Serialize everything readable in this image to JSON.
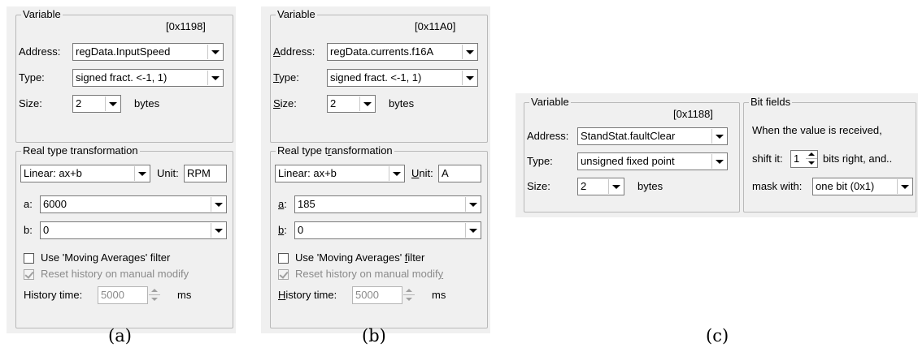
{
  "panel_a": {
    "caption": "(a)",
    "variable": {
      "legend": "Variable",
      "address_hex": "[0x1198]",
      "address_label": "Address:",
      "address_value": "regData.InputSpeed",
      "type_label": "Type:",
      "type_value": "signed fract. <-1, 1)",
      "size_label": "Size:",
      "size_value": "2",
      "size_unit": "bytes"
    },
    "transform": {
      "legend": "Real type transformation",
      "func_value": "Linear: ax+b",
      "unit_label": "Unit:",
      "unit_value": "RPM",
      "a_label": "a:",
      "a_value": "6000",
      "b_label": "b:",
      "b_value": "0",
      "filter_label": "Use 'Moving Averages' filter",
      "reset_label": "Reset history on manual modify",
      "history_label": "History time:",
      "history_value": "5000",
      "history_unit": "ms"
    }
  },
  "panel_b": {
    "caption": "(b)",
    "variable": {
      "legend": "Variable",
      "address_hex": "[0x11A0]",
      "address_label_u": "A",
      "address_label_rest": "ddress:",
      "address_value": "regData.currents.f16A",
      "type_label_u": "T",
      "type_label_rest": "ype:",
      "type_value": "signed fract. <-1, 1)",
      "size_label_u": "S",
      "size_label_rest": "ize:",
      "size_value": "2",
      "size_unit": "bytes"
    },
    "transform": {
      "legend_pre": "Real type t",
      "legend_u": "r",
      "legend_post": "ansformation",
      "func_value": "Linear: ax+b",
      "unit_label_u": "U",
      "unit_label_rest": "nit:",
      "unit_value": "A",
      "a_label_u": "a",
      "a_label_rest": ":",
      "a_value": "185",
      "b_label_u": "b",
      "b_label_rest": ":",
      "b_value": "0",
      "filter_label_pre": "Use 'Moving Averages' ",
      "filter_label_u": "f",
      "filter_label_post": "ilter",
      "reset_label_pre": "Reset history on manual modif",
      "reset_label_u": "y",
      "history_label_u": "H",
      "history_label_rest": "istory time:",
      "history_value": "5000",
      "history_unit": "ms"
    }
  },
  "panel_c": {
    "caption": "(c)",
    "variable": {
      "legend": "Variable",
      "address_hex": "[0x1188]",
      "address_label": "Address:",
      "address_value": "StandStat.faultClear",
      "type_label": "Type:",
      "type_value": "unsigned fixed point",
      "size_label": "Size:",
      "size_value": "2",
      "size_unit": "bytes"
    },
    "bitfields": {
      "legend": "Bit fields",
      "info": "When the value is received,",
      "shift_label": "shift it:",
      "shift_value": "1",
      "shift_suffix": "bits right, and..",
      "mask_label": "mask with:",
      "mask_value": "one bit (0x1)"
    }
  }
}
